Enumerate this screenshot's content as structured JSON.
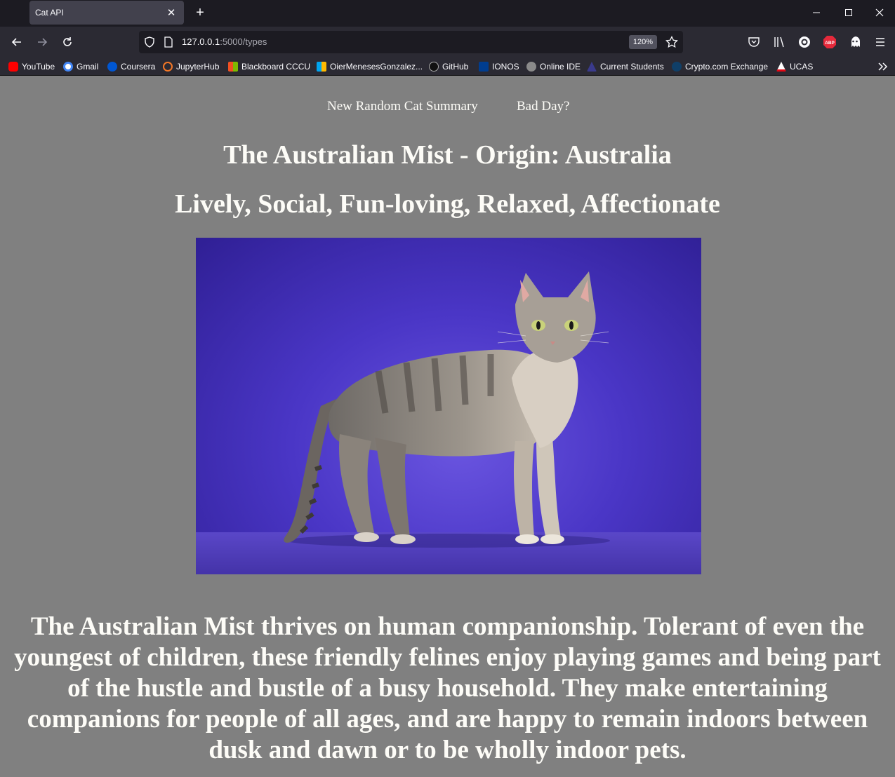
{
  "browser": {
    "tab_title": "Cat API",
    "url_host": "127.0.0.1",
    "url_path": ":5000/types",
    "zoom": "120%",
    "bookmarks": [
      {
        "label": "YouTube",
        "color": "#ff0000"
      },
      {
        "label": "Gmail",
        "color": "#ffffff"
      },
      {
        "label": "Coursera",
        "color": "#0056d2"
      },
      {
        "label": "JupyterHub",
        "color": "#f37726"
      },
      {
        "label": "Blackboard CCCU",
        "color": "#f25022"
      },
      {
        "label": "OierMenesesGonzalez...",
        "color": "#7fba00"
      },
      {
        "label": "GitHub",
        "color": "#24292e"
      },
      {
        "label": "IONOS",
        "color": "#003d8f"
      },
      {
        "label": "Online IDE",
        "color": "#8a8a8a"
      },
      {
        "label": "Current Students",
        "color": "#3a3a8c"
      },
      {
        "label": "Crypto.com Exchange",
        "color": "#103f68"
      },
      {
        "label": "UCAS",
        "color": "#e30613"
      }
    ]
  },
  "page": {
    "nav": {
      "random_label": "New Random Cat Summary",
      "bad_day_label": "Bad Day?"
    },
    "title": "The Australian Mist - Origin: Australia",
    "temperament": "Lively, Social, Fun-loving, Relaxed, Affectionate",
    "description": "The Australian Mist thrives on human companionship. Tolerant of even the youngest of children, these friendly felines enjoy playing games and being part of the hustle and bustle of a busy household. They make entertaining companions for people of all ages, and are happy to remain indoors between dusk and dawn or to be wholly indoor pets."
  }
}
